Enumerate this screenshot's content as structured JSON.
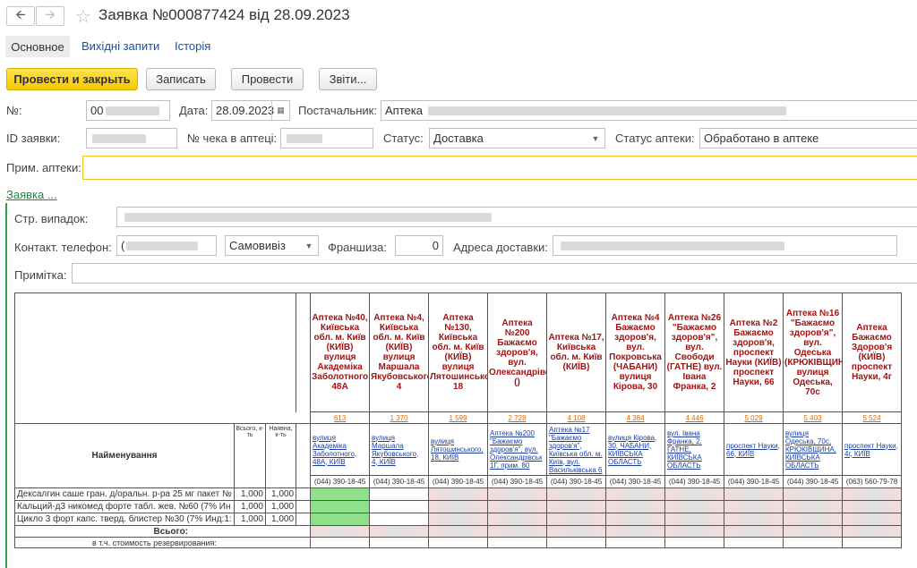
{
  "header": {
    "title": "Заявка №000877424 від 28.09.2023",
    "back_icon": "arrow-left-icon",
    "forward_icon": "arrow-right-icon",
    "star_icon": "star-icon"
  },
  "tabs": [
    "Основное",
    "Вихідні запити",
    "Історія"
  ],
  "toolbar": {
    "post_close": "Провести и закрыть",
    "save": "Записать",
    "post": "Провести",
    "reports": "Звіти..."
  },
  "form": {
    "number_label": "№:",
    "number_value": "00",
    "date_label": "Дата:",
    "date_value": "28.09.2023",
    "supplier_label": "Постачальник:",
    "supplier_value": "Аптека",
    "order_id_label": "ID заявки:",
    "check_label": "№ чека в аптеці:",
    "status_label": "Статус:",
    "status_value": "Доставка",
    "pharmacy_status_label": "Статус аптеки:",
    "pharmacy_status_value": "Обработано в аптеке",
    "note_label": "Прим. аптеки:"
  },
  "section_link": "Заявка ...",
  "section": {
    "insurance_label": "Стр. випадок:",
    "phone_label": "Контакт. телефон:",
    "phone_value": "(",
    "pickup_value": "Самовивіз",
    "franchise_label": "Франшиза:",
    "franchise_value": "0",
    "delivery_label": "Адреса доставки:",
    "remark_label": "Примітка:"
  },
  "table": {
    "name_header": "Найменування",
    "total_header": "Всього, к-ть",
    "avail_header": "Наявна, к-ть",
    "pharmacies": [
      {
        "title": "Аптека №40, Київська обл. м. Київ (КИЇВ) вулиця Академіка Заболотного 48А",
        "num": "613",
        "addr": "вулиця Академіка Заболотного, 48А, КИЇВ",
        "phone": "(044) 390-18-45"
      },
      {
        "title": "Аптека №4, Київська обл. м. Київ (КИЇВ) вулиця Маршала Якубовського 4",
        "num": "1 370",
        "addr": "вулиця Маршала Якубовського, 4, КИЇВ",
        "phone": "(044) 390-18-45"
      },
      {
        "title": "Аптека №130, Київська обл. м. Київ (КИЇВ) вулиця Лятошинсько 18",
        "num": "1 599",
        "addr": "вулиця Лятошинського, 18, КИЇВ",
        "phone": "(044) 390-18-45"
      },
      {
        "title": "Аптека №200 Бажаємо здоров'я, вул. Олександрівс ()",
        "num": "2 728",
        "addr": "Аптека №200 \"Бажаємо здоров'я\", вул. Олександрівськ 1Г, прим. 80",
        "phone": "(044) 390-18-45"
      },
      {
        "title": "Аптека №17, Київська обл. м. Київ (КИЇВ)",
        "num": "4 108",
        "addr": "Аптека №17 \"Бажаємо здоров'я\", Київська обл. м. Київ, вул. Васильківська 6",
        "phone": "(044) 390-18-45"
      },
      {
        "title": "Аптека №4 Бажаємо здоров'я, вул. Покровська (ЧАБАНИ) вулиця Кірова, 30",
        "num": "4 384",
        "addr": "вулиця Кірова, 30, ЧАБАНИ, КИЇВСЬКА ОБЛАСТЬ",
        "phone": "(044) 390-18-45"
      },
      {
        "title": "Аптека №26 \"Бажаємо здоров'я\", вул. Свободи (ГАТНЕ) вул. Івана Франка, 2",
        "num": "4 446",
        "addr": "вул. Івана Франка, 2, ГАТНЕ, КИЇВСЬКА ОБЛАСТЬ",
        "phone": "(044) 390-18-45"
      },
      {
        "title": "Аптека №2 Бажаємо здоров'я, проспект Науки (КИЇВ) проспект Науки, 66",
        "num": "5 029",
        "addr": "проспект Науки, 66, КИЇВ",
        "phone": "(044) 390-18-45"
      },
      {
        "title": "Аптека №16 \"Бажаємо здоров'я\", вул. Одеська (КРЮКІВЩИН вулиця Одеська, 70с",
        "num": "5 403",
        "addr": "вулиця Одеська, 70с, КРЮКІВЩИНА, КИЇВСЬКА ОБЛАСТЬ",
        "phone": "(044) 390-18-45"
      },
      {
        "title": "Аптека Бажаємо Здоров'я (КИЇВ) проспект Науки, 4г",
        "num": "5 524",
        "addr": "проспект Науки, 4г, КИЇВ",
        "phone": "(063) 560-79-78"
      }
    ],
    "rows": [
      {
        "name": "Дексалгин саше гран. д/оральн. р-ра 25 мг пакет №",
        "total": "1,000",
        "avail": "1,000"
      },
      {
        "name": "Кальций-д3 никомед форте табл. жев. №60 (7% Ин",
        "total": "1,000",
        "avail": "1,000"
      },
      {
        "name": "Цикло 3 форт капс. тверд. блистер №30 (7% Инд:1:",
        "total": "1,000",
        "avail": "1,000"
      }
    ],
    "total_label": "Всього:",
    "reserve_label": "в т.ч. стоимость резервирования:"
  }
}
